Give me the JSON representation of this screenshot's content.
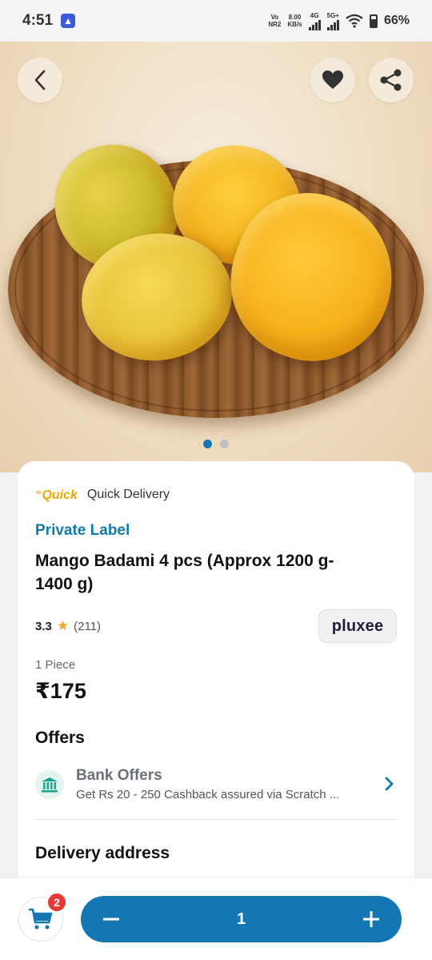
{
  "status_bar": {
    "time": "4:51",
    "net_top": "Vo",
    "net_bottom": "NR2",
    "speed_value": "8.00",
    "speed_unit": "KB/s",
    "sig1": "4G",
    "sig2": "5G+",
    "battery": "66%"
  },
  "hero": {
    "image_subject": "mango-on-wooden-board",
    "active_image_index": 1,
    "image_count": 2
  },
  "product": {
    "quick_logo": "Quick",
    "quick_label": "Quick Delivery",
    "brand": "Private Label",
    "title": "Mango Badami 4 pcs (Approx 1200 g-1400 g)",
    "rating": "3.3",
    "rating_count": "(211)",
    "payment_badge": "pluxee",
    "unit": "1 Piece",
    "price": "₹175"
  },
  "offers": {
    "title": "Offers",
    "items": [
      {
        "title": "Bank Offers",
        "desc": "Get  Rs 20 - 250 Cashback assured via Scratch ..."
      }
    ]
  },
  "delivery": {
    "title": "Delivery address"
  },
  "bottom": {
    "cart_count": "2",
    "minus_label": "−",
    "quantity": "1",
    "plus_label": "+"
  },
  "colors": {
    "accent": "#1477b3",
    "badge": "#e53935",
    "quick": "#f0a500",
    "star": "#f5a623"
  }
}
